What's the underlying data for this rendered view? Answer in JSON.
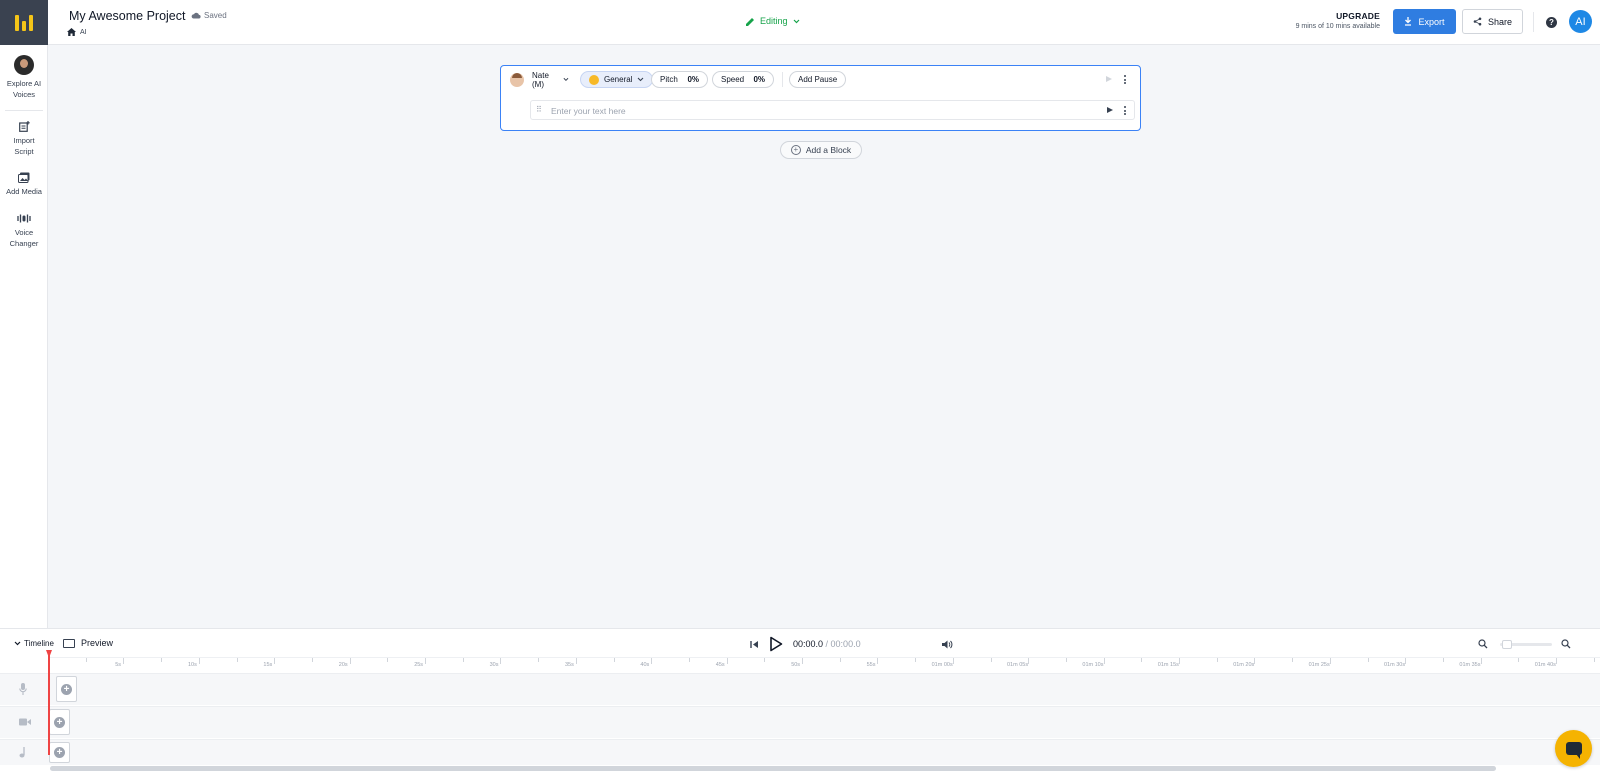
{
  "header": {
    "project_title": "My Awesome Project",
    "save_status": "Saved",
    "breadcrumb": "AI",
    "mode": "Editing",
    "upgrade": {
      "label": "UPGRADE",
      "usage": "9 mins of 10 mins available"
    },
    "export_label": "Export",
    "share_label": "Share",
    "help_label": "?",
    "avatar_initials": "AI"
  },
  "sidebar": {
    "items": [
      {
        "label": "Explore AI Voices",
        "icon": "voice-avatar-icon"
      },
      {
        "label": "Import Script",
        "icon": "import-script-icon"
      },
      {
        "label": "Add Media",
        "icon": "media-icon"
      },
      {
        "label": "Voice Changer",
        "icon": "voice-changer-icon"
      }
    ]
  },
  "block": {
    "voice_name": "Nate (M)",
    "style": "General",
    "pitch_label": "Pitch",
    "pitch_value": "0%",
    "speed_label": "Speed",
    "speed_value": "0%",
    "add_pause_label": "Add Pause",
    "text_placeholder": "Enter your text here"
  },
  "add_block_label": "Add a Block",
  "timeline": {
    "toggle_label": "Timeline",
    "preview_label": "Preview",
    "current_time": "00:00.0",
    "total_time": "/ 00:00.0",
    "ruler_labels": [
      "5s",
      "10s",
      "15s",
      "20s",
      "25s",
      "30s",
      "35s",
      "40s",
      "45s",
      "50s",
      "55s",
      "01m 00s",
      "01m 05s",
      "01m 10s",
      "01m 15s",
      "01m 20s",
      "01m 25s",
      "01m 30s",
      "01m 35s",
      "01m 40s"
    ],
    "tracks": [
      "voice",
      "video",
      "audio"
    ]
  },
  "colors": {
    "accent": "#2f7de1",
    "editing": "#16a34a",
    "playhead": "#ef4444",
    "chat": "#f5b301"
  }
}
